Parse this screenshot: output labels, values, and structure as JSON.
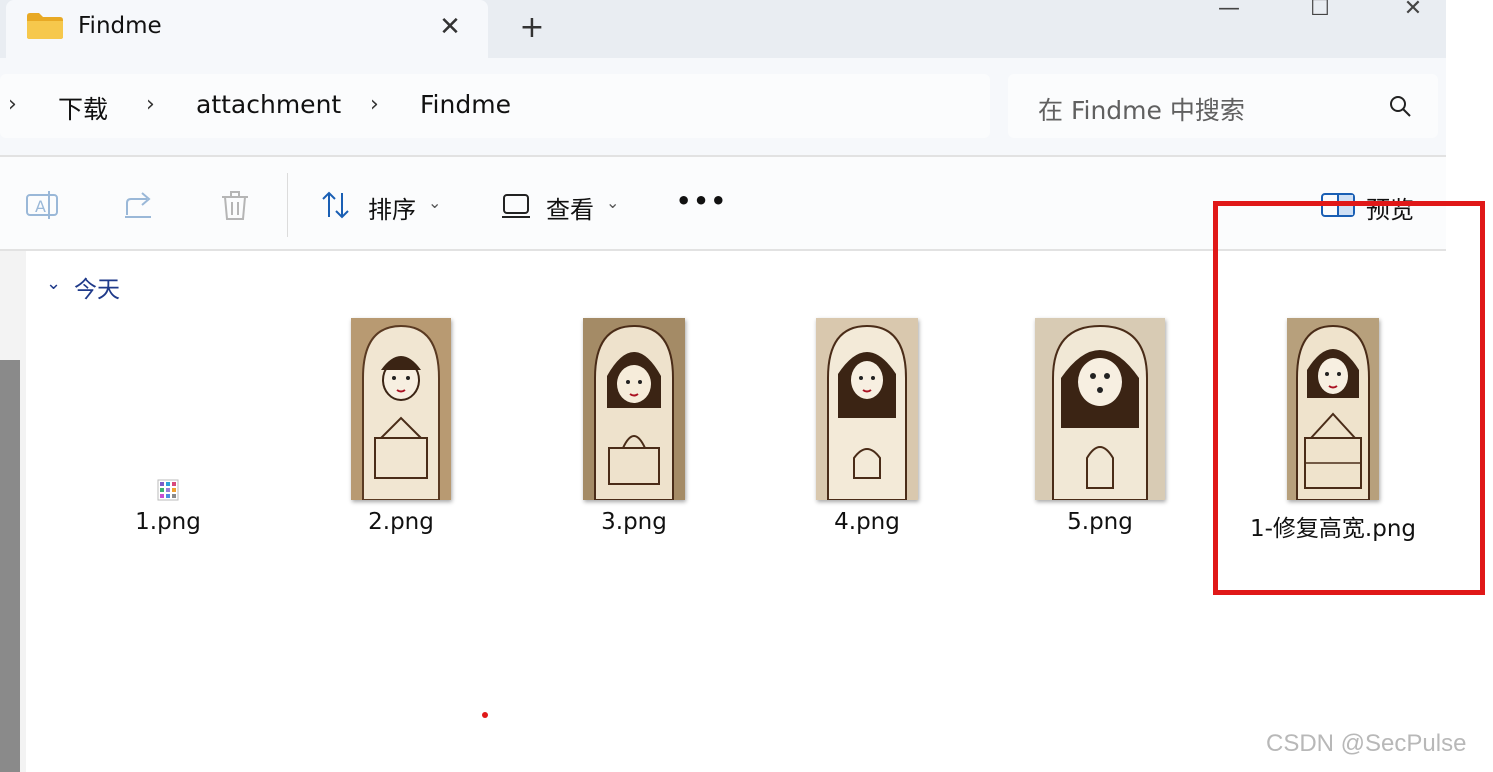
{
  "window": {
    "tab_title": "Findme",
    "tab_close_glyph": "✕",
    "new_tab_glyph": "+",
    "minimize_glyph": "—",
    "maximize_glyph": "☐",
    "close_glyph": "✕"
  },
  "breadcrumb": {
    "chevron": "›",
    "items": [
      "下载",
      "attachment",
      "Findme"
    ]
  },
  "search": {
    "placeholder": "在 Findme 中搜索",
    "icon": "search-icon"
  },
  "toolbar": {
    "rename_icon": "rename-icon",
    "share_icon": "share-icon",
    "delete_icon": "trash-icon",
    "sort_label": "排序",
    "view_label": "查看",
    "more_glyph": "•••",
    "preview_label": "预览",
    "caret": "⌄"
  },
  "group": {
    "label": "今天",
    "chevron": "⌄"
  },
  "files": [
    {
      "name": "1.png"
    },
    {
      "name": "2.png"
    },
    {
      "name": "3.png"
    },
    {
      "name": "4.png"
    },
    {
      "name": "5.png"
    },
    {
      "name": "1-修复高宽.png"
    }
  ],
  "watermark": "CSDN @SecPulse",
  "colors": {
    "accent": "#1f3a8a",
    "highlight_box": "#e01818",
    "folder": "#f3c046"
  }
}
